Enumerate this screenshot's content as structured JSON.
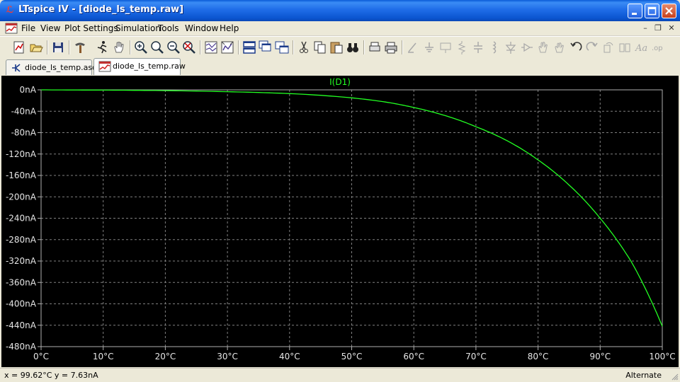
{
  "window": {
    "title": "LTspice IV - [diode_ls_temp.raw]"
  },
  "menu": {
    "items": [
      {
        "label": "File"
      },
      {
        "label": "View"
      },
      {
        "label": "Plot Settings"
      },
      {
        "label": "Simulation"
      },
      {
        "label": "Tools"
      },
      {
        "label": "Window"
      },
      {
        "label": "Help"
      }
    ]
  },
  "tabs": [
    {
      "label": "diode_ls_temp.asc",
      "active": false
    },
    {
      "label": "diode_ls_temp.raw",
      "active": true
    }
  ],
  "plot": {
    "trace_label": "I(D1)"
  },
  "chart_data": {
    "type": "line",
    "title": "I(D1)",
    "xlabel": "",
    "ylabel": "",
    "xlim": [
      0,
      100
    ],
    "ylim": [
      -480,
      0
    ],
    "x_ticks": [
      "0°C",
      "10°C",
      "20°C",
      "30°C",
      "40°C",
      "50°C",
      "60°C",
      "70°C",
      "80°C",
      "90°C",
      "100°C"
    ],
    "y_ticks": [
      "0nA",
      "-40nA",
      "-80nA",
      "-120nA",
      "-160nA",
      "-200nA",
      "-240nA",
      "-280nA",
      "-320nA",
      "-360nA",
      "-400nA",
      "-440nA",
      "-480nA"
    ],
    "grid": true,
    "series": [
      {
        "name": "I(D1)",
        "color": "#22ff22",
        "x": [
          0,
          10,
          20,
          30,
          40,
          50,
          55,
          60,
          65,
          70,
          75,
          80,
          85,
          90,
          95,
          100
        ],
        "y": [
          0,
          -0.5,
          -1.5,
          -3.5,
          -7,
          -15,
          -22,
          -33,
          -48,
          -69,
          -95,
          -131,
          -178,
          -240,
          -321,
          -442
        ]
      }
    ]
  },
  "status": {
    "coords": "x = 99.62°C    y = 7.63nA",
    "mode": "Alternate"
  },
  "colors": {
    "plot_bg": "#000000",
    "trace": "#22ff22",
    "grid": "#808080"
  }
}
